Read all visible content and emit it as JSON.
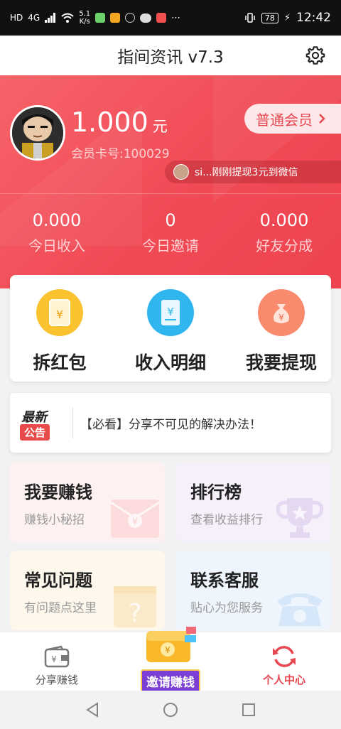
{
  "status_bar": {
    "left_icons": [
      "HD",
      "4G",
      "signal-icon",
      "wifi-icon"
    ],
    "speed_top": "5.1",
    "speed_bottom": "K/s",
    "battery": "78",
    "time": "12:42"
  },
  "title_bar": {
    "title": "指间资讯 v7.3",
    "settings_icon": "gear-icon"
  },
  "account": {
    "balance": "1.000",
    "unit": "元",
    "card_no": "会员卡号:100029",
    "member_level": "普通会员",
    "ticker": "si...刚刚提现3元到微信"
  },
  "stats": [
    {
      "value": "0.000",
      "label": "今日收入"
    },
    {
      "value": "0",
      "label": "今日邀请"
    },
    {
      "value": "0.000",
      "label": "好友分成"
    }
  ],
  "actions": [
    {
      "label": "拆红包",
      "icon": "red-envelope-icon",
      "color": "#fbc22f"
    },
    {
      "label": "收入明细",
      "icon": "receipt-icon",
      "color": "#2fb6ee"
    },
    {
      "label": "我要提现",
      "icon": "money-bag-icon",
      "color": "#f98a6c"
    }
  ],
  "notice": {
    "badge_top": "最新",
    "badge_bottom": "公告",
    "text": "【必看】分享不可见的解决办法！"
  },
  "tiles": [
    {
      "title": "我要赚钱",
      "sub": "赚钱小秘招",
      "bg": "#fdf1f1",
      "icon": "envelope-icon"
    },
    {
      "title": "排行榜",
      "sub": "查看收益排行",
      "bg": "#f6f0fb",
      "icon": "trophy-icon"
    },
    {
      "title": "常见问题",
      "sub": "有问题点这里",
      "bg": "#fef7ec",
      "icon": "question-icon"
    },
    {
      "title": "联系客服",
      "sub": "贴心为您服务",
      "bg": "#eef5fd",
      "icon": "phone-icon"
    }
  ],
  "tabs": [
    {
      "label": "分享赚钱",
      "icon": "wallet-icon",
      "active": false
    },
    {
      "label": "邀请赚钱",
      "icon": "gift-icon",
      "active": false
    },
    {
      "label": "个人中心",
      "icon": "refresh-icon",
      "active": true
    }
  ],
  "colors": {
    "accent": "#ee4450",
    "accent_text": "#e84650"
  }
}
